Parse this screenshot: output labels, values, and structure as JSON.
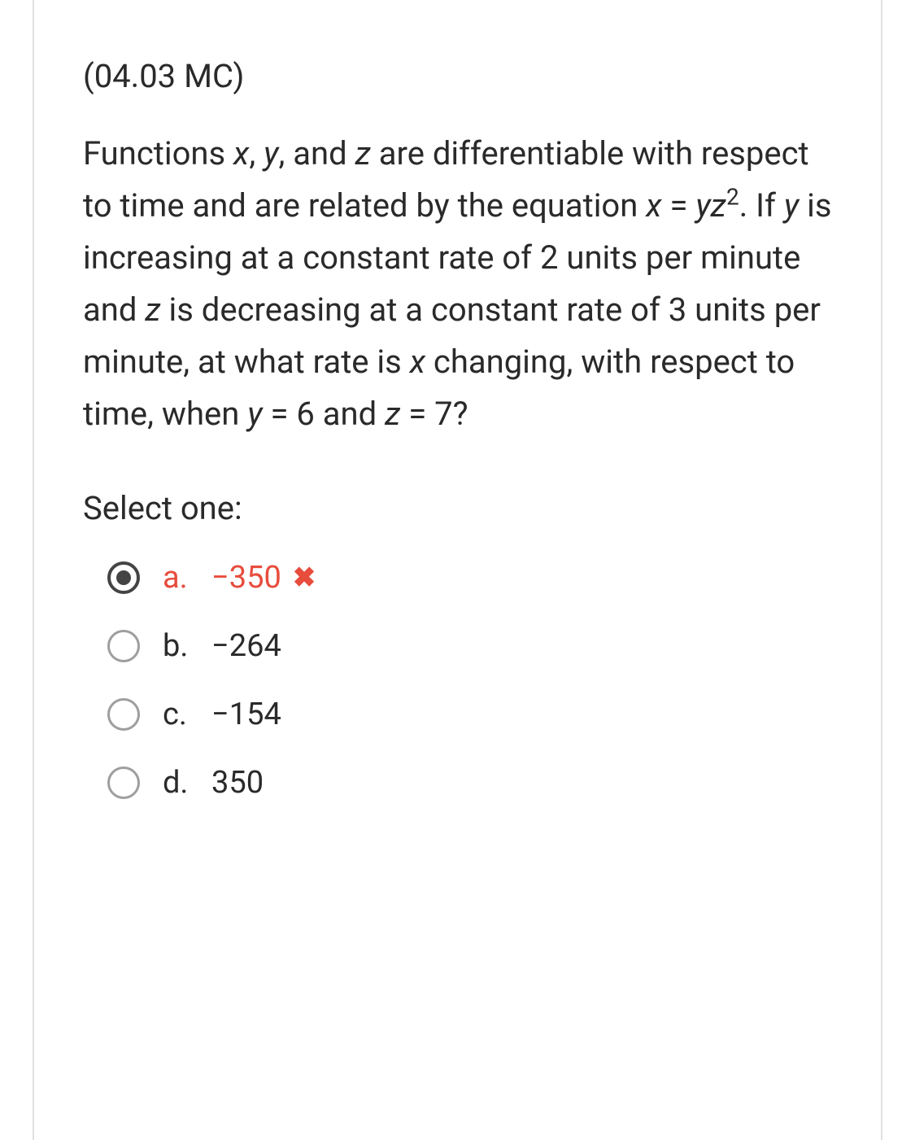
{
  "question": {
    "tag": "(04.03 MC)",
    "select_label": "Select one:",
    "options": [
      {
        "letter": "a.",
        "text": "−350",
        "selected": true,
        "incorrect": true
      },
      {
        "letter": "b.",
        "text": "−264",
        "selected": false,
        "incorrect": false
      },
      {
        "letter": "c.",
        "text": "−154",
        "selected": false,
        "incorrect": false
      },
      {
        "letter": "d.",
        "text": "350",
        "selected": false,
        "incorrect": false
      }
    ]
  },
  "question_text": {
    "part1": "Functions ",
    "x": "x",
    "comma1": ", ",
    "y": "y",
    "comma2": ", and ",
    "z": "z",
    "part2": " are differentiable with respect to time and are related by the equation ",
    "x2": "x",
    "eq": " = ",
    "yz": "yz",
    "exp": "2",
    "part3": ". If ",
    "y2": "y",
    "part4": " is increasing at a constant rate of 2 units per minute and ",
    "z2": "z",
    "part5": " is decreasing at a constant rate of 3 units per minute, at what rate is ",
    "x3": "x",
    "part6": " changing, with respect to time, when ",
    "y3": "y",
    "part7": " = 6 and ",
    "z3": "z",
    "part8": " = 7?"
  }
}
